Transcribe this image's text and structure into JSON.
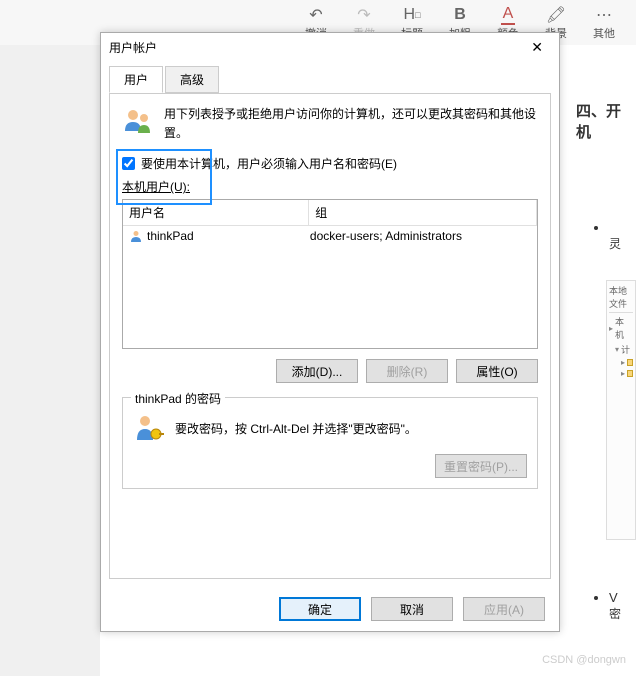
{
  "toolbar": {
    "undo": "撤消",
    "redo": "重做",
    "heading": "标题",
    "bold": "加粗",
    "color": "颜色",
    "background": "背景",
    "other": "其他"
  },
  "bg": {
    "section_title": "四、开机",
    "bullet2_prefix": "V",
    "bullet2_line2": "密",
    "mini_title1": "本地",
    "mini_title2": "文件",
    "mini_row1": "本机",
    "mini_row2": "计",
    "watermark": "CSDN @dongwn"
  },
  "dialog": {
    "title": "用户帐户",
    "tabs": {
      "users": "用户",
      "advanced": "高级"
    },
    "info_text": "用下列表授予或拒绝用户访问你的计算机，还可以更改其密码和其他设置。",
    "checkbox_label": "要使用本计算机，用户必须输入用户名和密码(E)",
    "list_label": "本机用户(U):",
    "columns": {
      "username": "用户名",
      "group": "组"
    },
    "rows": [
      {
        "username": "thinkPad",
        "group": "docker-users; Administrators"
      }
    ],
    "buttons": {
      "add": "添加(D)...",
      "remove": "删除(R)",
      "properties": "属性(O)"
    },
    "password_group": {
      "legend": "thinkPad 的密码",
      "text": "要改密码，按 Ctrl-Alt-Del 并选择\"更改密码\"。",
      "reset": "重置密码(P)..."
    },
    "footer": {
      "ok": "确定",
      "cancel": "取消",
      "apply": "应用(A)"
    }
  }
}
